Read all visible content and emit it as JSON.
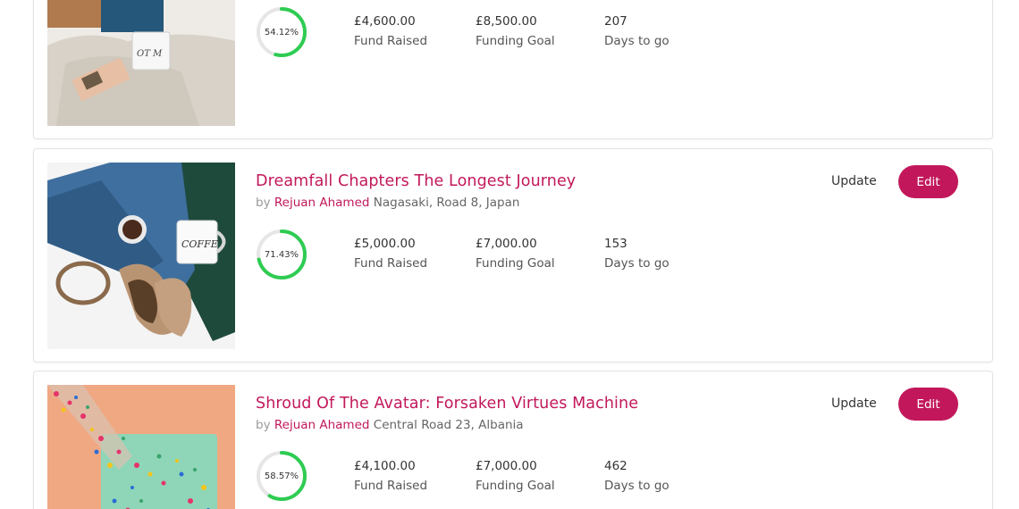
{
  "campaigns": [
    {
      "title": "",
      "by": "",
      "author": "",
      "location": "",
      "percent_label": "54.12%",
      "percent": 54.12,
      "raised": "£4,600.00",
      "raised_label": "Fund Raised",
      "goal": "£8,500.00",
      "goal_label": "Funding Goal",
      "days": "207",
      "days_label": "Days to go",
      "image": "photo-sweater-mug"
    },
    {
      "title": "Dreamfall Chapters The Longest Journey",
      "by": "by",
      "author": "Rejuan Ahamed",
      "location": "Nagasaki, Road 8, Japan",
      "percent_label": "71.43%",
      "percent": 71.43,
      "raised": "£5,000.00",
      "raised_label": "Fund Raised",
      "goal": "£7,000.00",
      "goal_label": "Funding Goal",
      "days": "153",
      "days_label": "Days to go",
      "update_label": "Update",
      "edit_label": "Edit",
      "image": "photo-jeans-shoes-coffee"
    },
    {
      "title": "Shroud Of The Avatar: Forsaken Virtues Machine",
      "by": "by",
      "author": "Rejuan Ahamed",
      "location": "Central Road 23, Albania",
      "percent_label": "58.57%",
      "percent": 58.57,
      "raised": "£4,100.00",
      "raised_label": "Fund Raised",
      "goal": "£7,000.00",
      "goal_label": "Funding Goal",
      "days": "462",
      "days_label": "Days to go",
      "update_label": "Update",
      "edit_label": "Edit",
      "image": "photo-glitter"
    }
  ],
  "colors": {
    "accent": "#c2185b",
    "progress": "#2ecc52",
    "track": "#e6e6e6"
  }
}
